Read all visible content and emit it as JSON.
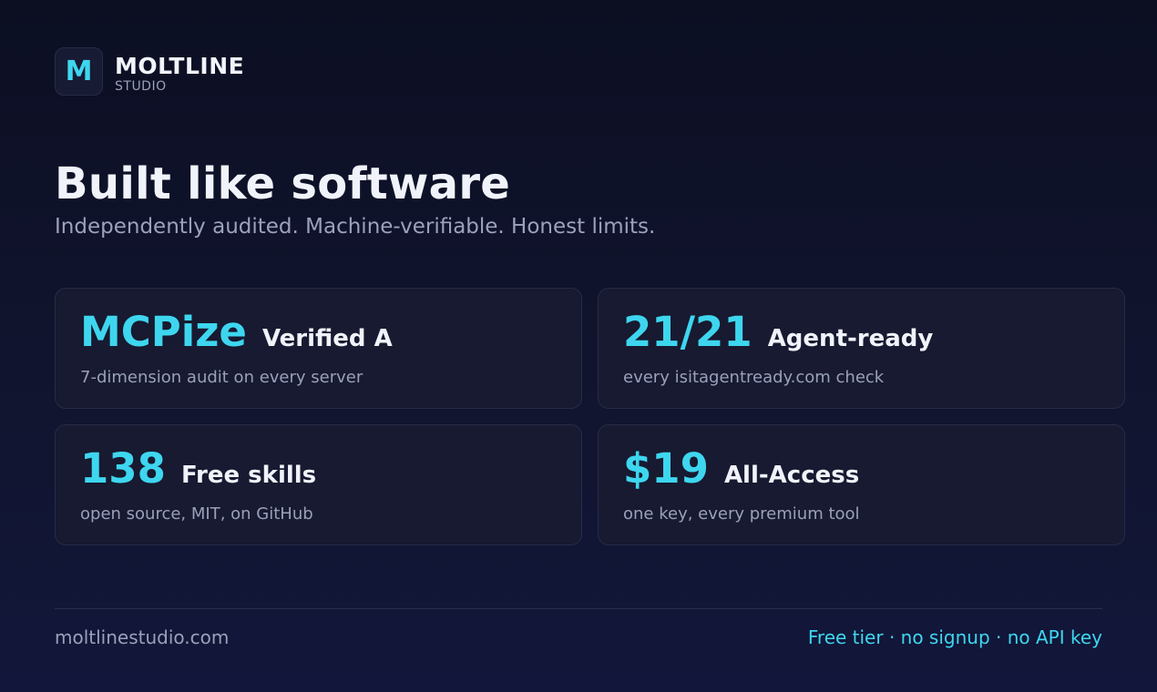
{
  "brand": {
    "logo_letter": "M",
    "name": "MOLTLINE",
    "sub": "STUDIO"
  },
  "hero": {
    "title": "Built like software",
    "subtitle": "Independently audited. Machine-verifiable. Honest limits."
  },
  "cards": [
    {
      "value": "MCPize",
      "label": "Verified A",
      "desc": "7-dimension audit on every server"
    },
    {
      "value": "21/21",
      "label": "Agent-ready",
      "desc": "every isitagentready.com check"
    },
    {
      "value": "138",
      "label": "Free skills",
      "desc": "open source, MIT, on GitHub"
    },
    {
      "value": "$19",
      "label": "All-Access",
      "desc": "one key, every premium tool"
    }
  ],
  "footer": {
    "domain": "moltlinestudio.com",
    "tagline": "Free tier · no signup · no API key"
  },
  "colors": {
    "accent": "#3ed6ef",
    "background": "#111530",
    "card": "#171a30",
    "text": "#f1f3fb",
    "muted": "#9aa0ba"
  }
}
